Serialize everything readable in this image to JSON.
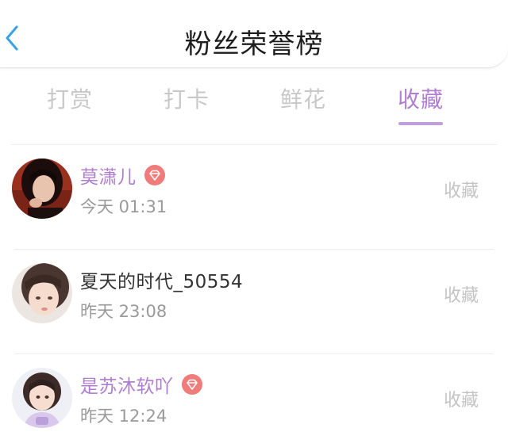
{
  "header": {
    "title": "粉丝荣誉榜",
    "back_icon": "chevron-left-icon"
  },
  "colors": {
    "accent": "#b07ed0",
    "back": "#3aa3e8",
    "badge": "#f07b7b",
    "inactive_tab": "#c8c8c8"
  },
  "tabs": [
    {
      "label": "打赏",
      "active": false
    },
    {
      "label": "打卡",
      "active": false
    },
    {
      "label": "鲜花",
      "active": false
    },
    {
      "label": "收藏",
      "active": true
    }
  ],
  "fans": [
    {
      "name": "莫潇儿",
      "time": "今天 01:31",
      "action": "收藏",
      "vip": true
    },
    {
      "name": "夏天的时代_50554",
      "time": "昨天 23:08",
      "action": "收藏",
      "vip": false
    },
    {
      "name": "是苏沐软吖",
      "time": "昨天 12:24",
      "action": "收藏",
      "vip": true
    }
  ]
}
